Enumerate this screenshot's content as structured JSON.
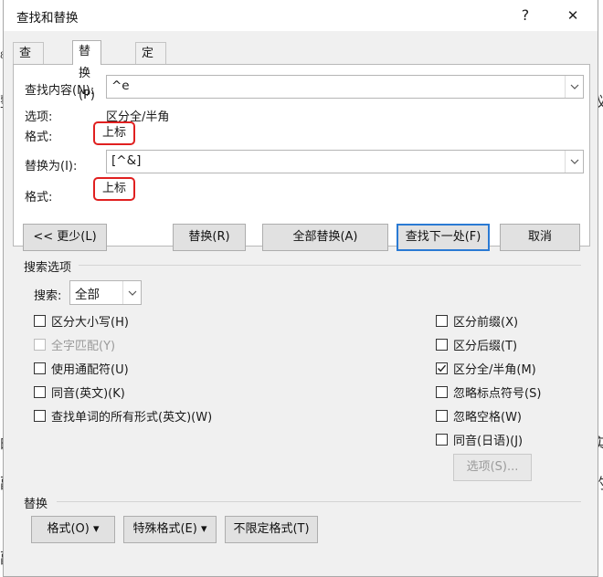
{
  "dialog": {
    "title": "查找和替换",
    "help_label": "?",
    "close_label": "✕"
  },
  "tabs": [
    {
      "label": "查找(D)"
    },
    {
      "label": "替换(P)"
    },
    {
      "label": "定位(G)"
    }
  ],
  "find": {
    "label": "查找内容(N):",
    "value": "^e",
    "options_label": "选项:",
    "options_value": "区分全/半角",
    "format_label": "格式:",
    "format_value": "上标"
  },
  "replace": {
    "label": "替换为(I):",
    "value": "[^&]",
    "format_label": "格式:",
    "format_value": "上标"
  },
  "buttons": {
    "less": "<< 更少(L)",
    "replace": "替换(R)",
    "replace_all": "全部替换(A)",
    "find_next": "查找下一处(F)",
    "cancel": "取消"
  },
  "search_options": {
    "heading": "搜索选项",
    "search_label": "搜索:",
    "search_value": "全部",
    "left_checks": [
      {
        "label": "区分大小写(H)",
        "checked": false,
        "disabled": false
      },
      {
        "label": "全字匹配(Y)",
        "checked": false,
        "disabled": true
      },
      {
        "label": "使用通配符(U)",
        "checked": false,
        "disabled": false
      },
      {
        "label": "同音(英文)(K)",
        "checked": false,
        "disabled": false
      },
      {
        "label": "查找单词的所有形式(英文)(W)",
        "checked": false,
        "disabled": false
      }
    ],
    "right_checks": [
      {
        "label": "区分前缀(X)",
        "checked": false
      },
      {
        "label": "区分后缀(T)",
        "checked": false
      },
      {
        "label": "区分全/半角(M)",
        "checked": true
      },
      {
        "label": "忽略标点符号(S)",
        "checked": false
      },
      {
        "label": "忽略空格(W)",
        "checked": false
      },
      {
        "label": "同音(日语)(J)",
        "checked": false
      }
    ],
    "options_button": "选项(S)..."
  },
  "replace_section": {
    "heading": "替换",
    "format_button": "格式(O) ▾",
    "special_button": "特殊格式(E) ▾",
    "no_format_button": "不限定格式(T)"
  },
  "background": {
    "left_chars": [
      "8",
      "整",
      "的",
      "副",
      "副",
      "调"
    ],
    "right_chars": [
      "8",
      "议",
      "实",
      "的",
      "。"
    ]
  },
  "colors": {
    "highlight_border": "#e02020",
    "default_button_border": "#2a7ad4"
  }
}
